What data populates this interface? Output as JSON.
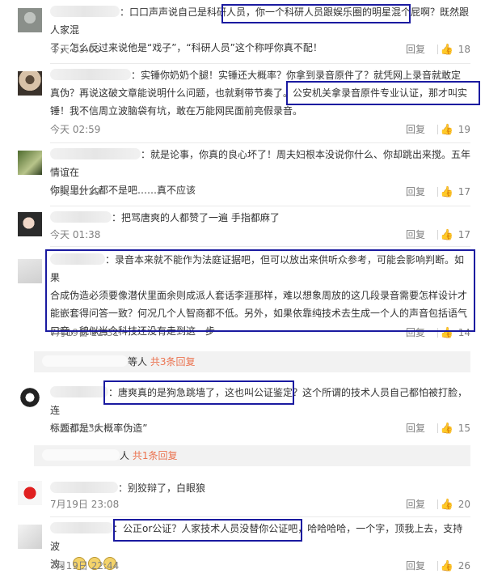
{
  "ui": {
    "reply_label": "回复",
    "accent_color": "#eb7350",
    "highlight_color": "#1a1aa0"
  },
  "comments": [
    {
      "line1": "：口口声声说自己是科研人员，你一个科研人员跟娱乐圈的明星混个屁啊？既然跟人家混",
      "line2": "了，怎么反过来说他是“戏子”，“科研人员”这个称呼你真不配！",
      "time": "今天 03:05",
      "likes": "18"
    },
    {
      "line1": "：实锤你奶奶个腿！实锤还大概率？你拿到录音原件了？就凭网上录音就敢定",
      "line2": "真伪？再说这破文章能说明什么问题，也就剩带节奏了。公安机关拿录音原件专业认证，那才叫实",
      "line3": "锤！我不信周立波脑袋有坑，敢在万能网民面前亮假录音。",
      "time": "今天 02:59",
      "likes": "19"
    },
    {
      "line1": "：就是论事，你真的良心坏了！周夫妇根本没说你什么、你却跳出来搅。五年情谊在",
      "line2": "你眼里什么都不是吧……真不应该",
      "time": "今天 02:39",
      "likes": "17"
    },
    {
      "line1": "：把骂唐爽的人都赞了一遍 手指都麻了",
      "time": "今天 01:38",
      "likes": "17"
    },
    {
      "line1": "：录音本来就不能作为法庭证据吧，但可以放出来供听众参考，可能会影响判断。如果",
      "line2": "合成伪造必须要像潜伏里面余则成派人套话李涯那样，难以想象周放的这几段录音需要怎样设计才",
      "line3": "能嵌套得问答一致？何况几个人智商都不低。另外，如果依靠纯技术去生成一个人的声音包括语气",
      "line4": "口音，貌似当今科技还没有走到这一步",
      "time": "7月19日 22:31",
      "likes": "14"
    },
    {
      "line1": "：唐爽真的是狗急跳墙了，这也叫公证鉴定？这个所谓的技术人员自己都怕被打脸，连",
      "line2": "标题都是“大概率伪造”",
      "time": "今天 02:30",
      "likes": "15"
    },
    {
      "line1": "：别狡辩了，白眼狼",
      "time": "7月19日 23:08",
      "likes": "20"
    },
    {
      "line1": "：公正or公证？人家技术人员没替你公证吧，哈哈哈哈，一个字，顶我上去，支持波",
      "line2": "波。",
      "time": "7月19日 22:44",
      "likes": "26"
    }
  ],
  "sub_threads": [
    {
      "prefix": "等人",
      "count": "共3条回复"
    },
    {
      "prefix": "人",
      "count": "共1条回复"
    }
  ]
}
